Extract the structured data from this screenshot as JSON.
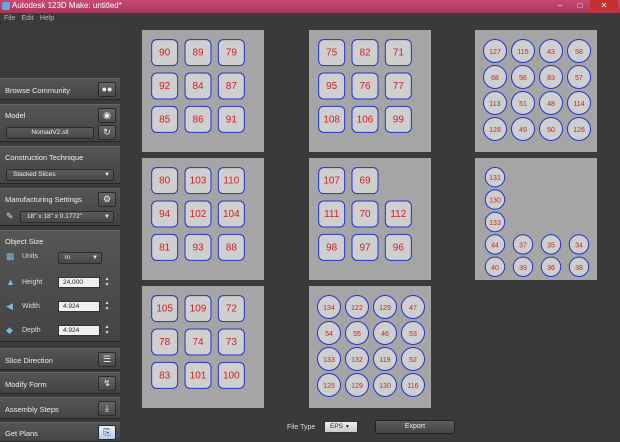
{
  "window": {
    "title": "Autodesk 123D Make: untitled*",
    "min": "–",
    "max": "□",
    "close": "✕"
  },
  "menu": [
    "File",
    "Edit",
    "Help"
  ],
  "sidebar": {
    "browse": "Browse Community",
    "model": "Model",
    "model_file": "NomadV2.stl",
    "technique": "Construction Technique",
    "technique_value": "Stacked Slices",
    "manufacturing": "Manufacturing Settings",
    "material": "18\" x 18\" x 0.1772\"",
    "object_size": "Object Size",
    "units_label": "Units",
    "units_value": "in",
    "height_label": "Height",
    "height_value": "24.000",
    "width_label": "Width",
    "width_value": "4.924",
    "depth_label": "Depth",
    "depth_value": "4.924",
    "slice_direction": "Slice Direction",
    "modify_form": "Modify Form",
    "assembly": "Assembly Steps",
    "get_plans": "Get Plans"
  },
  "bottom": {
    "file_type_label": "File Type",
    "file_type_value": "EPS",
    "export": "Export"
  },
  "colors": {
    "sheet": "#a5a5a5",
    "piece_fill": "#cfcfcf",
    "piece_stroke": "#2233cc",
    "label": "#cc2222",
    "highlight": "#cc2266"
  },
  "sheets": [
    {
      "rows": [
        [
          "90",
          "89",
          "79"
        ],
        [
          "92",
          "84",
          "87"
        ],
        [
          "85",
          "86",
          "91"
        ]
      ],
      "shape": "square"
    },
    {
      "rows": [
        [
          "75",
          "82",
          "71"
        ],
        [
          "95",
          "76",
          "77"
        ],
        [
          "108",
          "106",
          "99"
        ]
      ],
      "shape": "square"
    },
    {
      "rows": [
        [
          "127",
          "115",
          "43",
          "58"
        ],
        [
          "68",
          "56",
          "83",
          "57"
        ],
        [
          "113",
          "51",
          "48",
          "114"
        ],
        [
          "128",
          "49",
          "50",
          "126"
        ]
      ],
      "shape": "circle"
    },
    {
      "rows": [
        [
          "80",
          "103",
          "110"
        ],
        [
          "94",
          "102",
          "104"
        ],
        [
          "81",
          "93",
          "88"
        ]
      ],
      "shape": "square"
    },
    {
      "rows": [
        [
          "107",
          "69",
          ""
        ],
        [
          "111",
          "70",
          "112"
        ],
        [
          "98",
          "97",
          "96"
        ]
      ],
      "shape": "square"
    },
    {
      "rows": [
        [
          "131"
        ],
        [
          "130"
        ],
        [
          "133"
        ],
        [
          "44",
          "37",
          "35",
          "34"
        ],
        [
          "40",
          "39",
          "36",
          "38"
        ]
      ],
      "shape": "circle"
    },
    {
      "rows": [
        [
          "105",
          "109",
          "72"
        ],
        [
          "78",
          "74",
          "73"
        ],
        [
          "83",
          "101",
          "100"
        ]
      ],
      "shape": "square"
    },
    {
      "rows": [
        [
          "134",
          "122",
          "129",
          "47"
        ],
        [
          "54",
          "55",
          "46",
          "53"
        ],
        [
          "133",
          "132",
          "119",
          "52"
        ],
        [
          "125",
          "129",
          "130",
          "116"
        ]
      ],
      "shape": "circle"
    }
  ]
}
